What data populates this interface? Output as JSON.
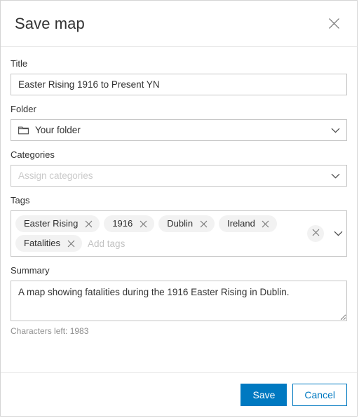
{
  "dialog": {
    "title": "Save map",
    "close_icon": "close-icon"
  },
  "form": {
    "title_field": {
      "label": "Title",
      "value": "Easter Rising 1916 to Present YN",
      "placeholder": "Title"
    },
    "folder_field": {
      "label": "Folder",
      "value": "Your folder",
      "icon": "folder-icon",
      "chevron": "chevron-down-icon"
    },
    "categories_field": {
      "label": "Categories",
      "value": "",
      "placeholder": "Assign categories",
      "chevron": "chevron-down-icon"
    },
    "tags_field": {
      "label": "Tags",
      "placeholder": "Add tags",
      "chips": [
        {
          "label": "Easter Rising",
          "remove_icon": "close-icon"
        },
        {
          "label": "1916",
          "remove_icon": "close-icon"
        },
        {
          "label": "Dublin",
          "remove_icon": "close-icon"
        },
        {
          "label": "Ireland",
          "remove_icon": "close-icon"
        },
        {
          "label": "Fatalities",
          "remove_icon": "close-icon"
        }
      ],
      "clear_icon": "close-icon",
      "chevron": "chevron-down-icon"
    },
    "summary_field": {
      "label": "Summary",
      "value": "A map showing fatalities during the 1916 Easter Rising in Dublin.",
      "placeholder": "Summary",
      "characters_left": "Characters left: 1983"
    }
  },
  "footer": {
    "save_label": "Save",
    "cancel_label": "Cancel"
  },
  "colors": {
    "accent": "#0079c1",
    "border": "#c6c6c6",
    "chip_bg": "#f2f2f2",
    "text": "#323232",
    "placeholder": "#bcbcbc"
  }
}
